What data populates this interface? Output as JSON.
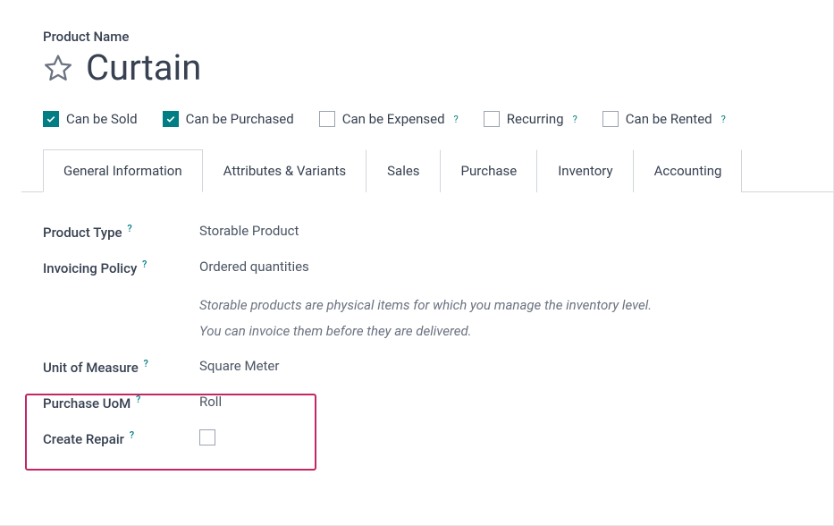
{
  "header": {
    "label": "Product Name",
    "title": "Curtain"
  },
  "options": {
    "sold": {
      "label": "Can be Sold",
      "checked": true,
      "help": false
    },
    "purchased": {
      "label": "Can be Purchased",
      "checked": true,
      "help": false
    },
    "expensed": {
      "label": "Can be Expensed",
      "checked": false,
      "help": true
    },
    "recurring": {
      "label": "Recurring",
      "checked": false,
      "help": true
    },
    "rented": {
      "label": "Can be Rented",
      "checked": false,
      "help": true
    }
  },
  "tabs": {
    "general": "General Information",
    "attributes": "Attributes & Variants",
    "sales": "Sales",
    "purchase": "Purchase",
    "inventory": "Inventory",
    "accounting": "Accounting"
  },
  "fields": {
    "product_type": {
      "label": "Product Type",
      "value": "Storable Product"
    },
    "invoicing_policy": {
      "label": "Invoicing Policy",
      "value": "Ordered quantities"
    },
    "hint_line1": "Storable products are physical items for which you manage the inventory level.",
    "hint_line2": "You can invoice them before they are delivered.",
    "uom": {
      "label": "Unit of Measure",
      "value": "Square Meter"
    },
    "purchase_uom": {
      "label": "Purchase UoM",
      "value": "Roll"
    },
    "create_repair": {
      "label": "Create Repair"
    }
  },
  "glyphs": {
    "help": "?"
  }
}
